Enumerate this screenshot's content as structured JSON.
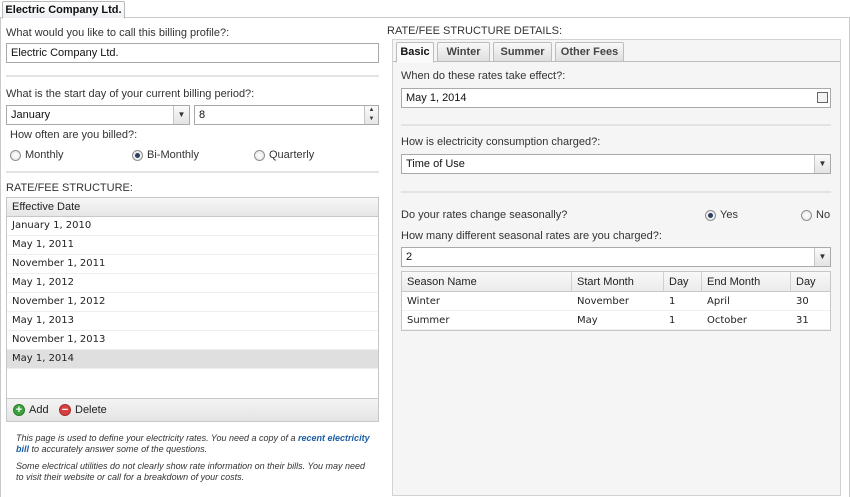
{
  "window": {
    "tab_title": "Electric Company Ltd."
  },
  "left": {
    "profile_question": "What would you like to call this billing profile?:",
    "profile_value": "Electric Company Ltd.",
    "start_day_question": "What is the start day of your current billing period?:",
    "start_month_value": "January",
    "start_day_value": "8",
    "billed_question": "How often are you billed?:",
    "billing_options": [
      "Monthly",
      "Bi-Monthly",
      "Quarterly"
    ],
    "billing_selected": "Bi-Monthly",
    "structure_label": "RATE/FEE STRUCTURE:",
    "grid_header": "Effective Date",
    "dates": [
      "January 1, 2010",
      "May 1, 2011",
      "November 1, 2011",
      "May 1, 2012",
      "November 1, 2012",
      "May 1, 2013",
      "November 1, 2013",
      "May 1, 2014"
    ],
    "selected_date": "May 1, 2014",
    "add_label": "Add",
    "delete_label": "Delete",
    "note1_pre": "This page is used to define your electricity rates. You need a copy of a",
    "note1_link_a": "recent electricity",
    "note1_link_b": "bill",
    "note1_post": "to accurately answer some of the questions.",
    "note2_line1": "Some electrical utilities do not clearly show rate information on their bills. You may need",
    "note2_line2": "to visit their website or call for a breakdown of your costs."
  },
  "right": {
    "details_label": "RATE/FEE STRUCTURE DETAILS:",
    "tabs": [
      "Basic",
      "Winter",
      "Summer",
      "Other Fees"
    ],
    "active_tab": "Basic",
    "effective_question": "When do these rates take effect?:",
    "effective_value": "May 1, 2014",
    "consumption_question": "How is electricity consumption charged?:",
    "consumption_value": "Time of Use",
    "seasonal_question": "Do your rates change seasonally?",
    "seasonal_yes": "Yes",
    "seasonal_no": "No",
    "seasonal_selected": "Yes",
    "count_question": "How many different seasonal rates are you charged?:",
    "count_value": "2",
    "season_columns": [
      "Season Name",
      "Start Month",
      "Day",
      "End Month",
      "Day"
    ],
    "seasons": [
      [
        "Winter",
        "November",
        "1",
        "April",
        "30"
      ],
      [
        "Summer",
        "May",
        "1",
        "October",
        "31"
      ]
    ]
  }
}
